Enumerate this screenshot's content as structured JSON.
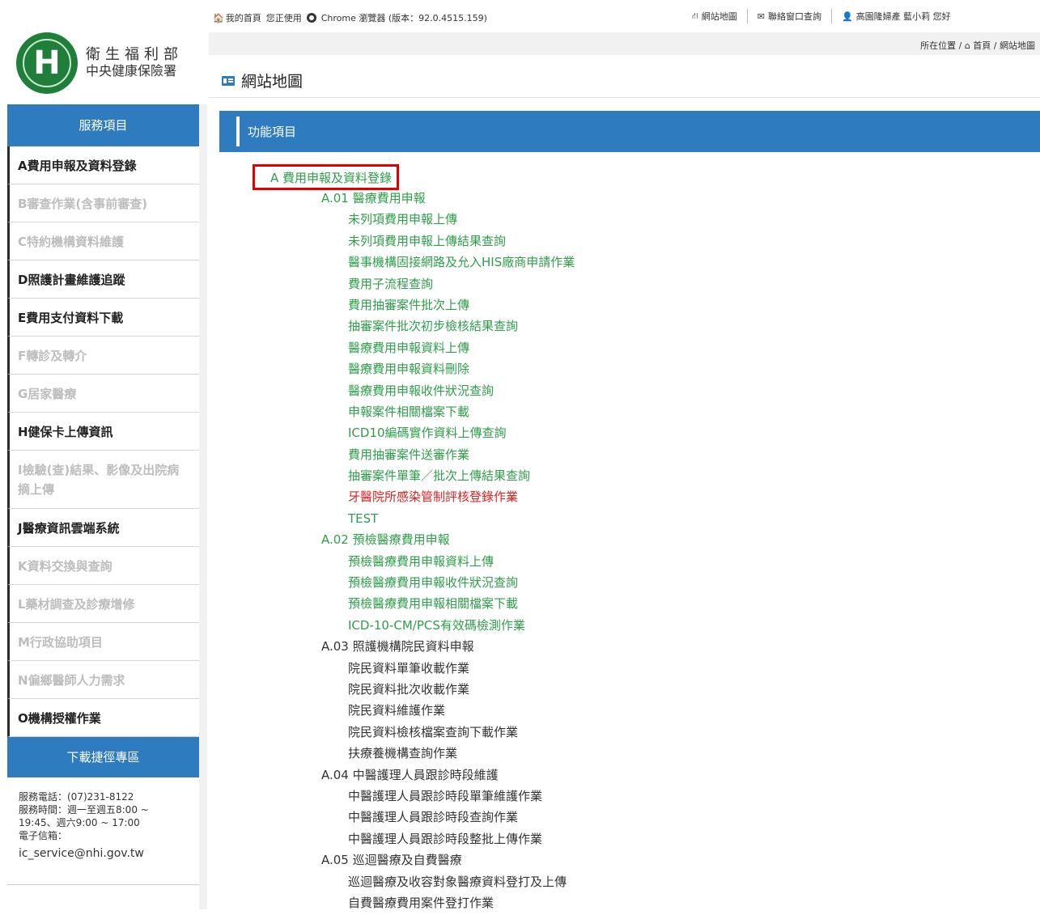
{
  "topbar": {
    "home": "我的首頁",
    "browser_prefix": "您正使用",
    "browser_text": "Chrome 瀏覽器 (版本：92.0.4515.159)",
    "sitemap": "網站地圖",
    "contact": "聯絡窗口查詢",
    "user": "高園隆婦產 藍小莉 您好"
  },
  "breadcrumb": {
    "prefix": "所在位置 /",
    "home": "首頁",
    "current": "/ 網站地圖"
  },
  "logo": {
    "line1": "衛生福利部",
    "line2": "中央健康保險署"
  },
  "sidebar": {
    "head": "服務項目",
    "items": [
      {
        "label": "A費用申報及資料登錄",
        "enabled": true
      },
      {
        "label": "B審查作業(含事前審查)",
        "enabled": false
      },
      {
        "label": "C特約機構資料維護",
        "enabled": false
      },
      {
        "label": "D照護計畫維護追蹤",
        "enabled": true
      },
      {
        "label": "E費用支付資料下載",
        "enabled": true
      },
      {
        "label": "F轉診及轉介",
        "enabled": false
      },
      {
        "label": "G居家醫療",
        "enabled": false
      },
      {
        "label": "H健保卡上傳資訊",
        "enabled": true
      },
      {
        "label": "I檢驗(查)結果、影像及出院病摘上傳",
        "enabled": false
      },
      {
        "label": "J醫療資訊雲端系統",
        "enabled": true
      },
      {
        "label": "K資料交換與查詢",
        "enabled": false
      },
      {
        "label": "L藥材調查及診療增修",
        "enabled": false
      },
      {
        "label": "M行政協助項目",
        "enabled": false
      },
      {
        "label": "N偏鄉醫師人力需求",
        "enabled": false
      },
      {
        "label": "O機構授權作業",
        "enabled": true
      }
    ],
    "download_head": "下載捷徑專區",
    "contact": {
      "phone": "服務電話：(07)231-8122",
      "hours1": "服務時間：週一至週五8:00 ~",
      "hours2": "19:45、週六9:00 ~ 17:00",
      "email_label": "電子信箱：",
      "email": "ic_service@nhi.gov.tw"
    }
  },
  "main": {
    "title": "網站地圖",
    "func_header": "功能項目",
    "section": "A 費用申報及資料登錄",
    "tree": [
      {
        "text": "A.01 醫療費用申報",
        "level": 1,
        "style": "green"
      },
      {
        "text": "未列項費用申報上傳",
        "level": 2,
        "style": "green"
      },
      {
        "text": "未列項費用申報上傳結果查詢",
        "level": 2,
        "style": "green"
      },
      {
        "text": "醫事機構固接網路及允入HIS廠商申請作業",
        "level": 2,
        "style": "green"
      },
      {
        "text": "費用子流程查詢",
        "level": 2,
        "style": "green"
      },
      {
        "text": "費用抽審案件批次上傳",
        "level": 2,
        "style": "green"
      },
      {
        "text": "抽審案件批次初步檢核結果查詢",
        "level": 2,
        "style": "green"
      },
      {
        "text": "醫療費用申報資料上傳",
        "level": 2,
        "style": "green"
      },
      {
        "text": "醫療費用申報資料刪除",
        "level": 2,
        "style": "green"
      },
      {
        "text": "醫療費用申報收件狀況查詢",
        "level": 2,
        "style": "green"
      },
      {
        "text": "申報案件相關檔案下載",
        "level": 2,
        "style": "green"
      },
      {
        "text": "ICD10編碼實作資料上傳查詢",
        "level": 2,
        "style": "green"
      },
      {
        "text": "費用抽審案件送審作業",
        "level": 2,
        "style": "green"
      },
      {
        "text": "抽審案件單筆／批次上傳結果查詢",
        "level": 2,
        "style": "green"
      },
      {
        "text": "牙醫院所感染管制評核登錄作業",
        "level": 2,
        "style": "red"
      },
      {
        "text": "TEST",
        "level": 2,
        "style": "green"
      },
      {
        "text": "A.02 預檢醫療費用申報",
        "level": 1,
        "style": "green"
      },
      {
        "text": "預檢醫療費用申報資料上傳",
        "level": 2,
        "style": "green"
      },
      {
        "text": "預檢醫療費用申報收件狀況查詢",
        "level": 2,
        "style": "green"
      },
      {
        "text": "預檢醫療費用申報相關檔案下載",
        "level": 2,
        "style": "green"
      },
      {
        "text": "ICD-10-CM/PCS有效碼檢測作業",
        "level": 2,
        "style": "green"
      },
      {
        "text": "A.03 照護機構院民資料申報",
        "level": 1,
        "style": "plain"
      },
      {
        "text": "院民資料單筆收載作業",
        "level": 2,
        "style": "plain"
      },
      {
        "text": "院民資料批次收載作業",
        "level": 2,
        "style": "plain"
      },
      {
        "text": "院民資料維護作業",
        "level": 2,
        "style": "plain"
      },
      {
        "text": "院民資料檢核檔案查詢下載作業",
        "level": 2,
        "style": "plain"
      },
      {
        "text": "扶療養機構查詢作業",
        "level": 2,
        "style": "plain"
      },
      {
        "text": "A.04 中醫護理人員跟診時段維護",
        "level": 1,
        "style": "plain"
      },
      {
        "text": "中醫護理人員跟診時段單筆維護作業",
        "level": 2,
        "style": "plain"
      },
      {
        "text": "中醫護理人員跟診時段查詢作業",
        "level": 2,
        "style": "plain"
      },
      {
        "text": "中醫護理人員跟診時段整批上傳作業",
        "level": 2,
        "style": "plain"
      },
      {
        "text": "A.05 巡迴醫療及自費醫療",
        "level": 1,
        "style": "plain"
      },
      {
        "text": "巡迴醫療及收容對象醫療資料登打及上傳",
        "level": 2,
        "style": "plain"
      },
      {
        "text": "自費醫療費用案件登打作業",
        "level": 2,
        "style": "plain"
      }
    ]
  },
  "colors": {
    "primary": "#2e7bbf",
    "link_green": "#2e9e4a",
    "alert_red": "#e02020",
    "highlight_box": "#e00000"
  }
}
